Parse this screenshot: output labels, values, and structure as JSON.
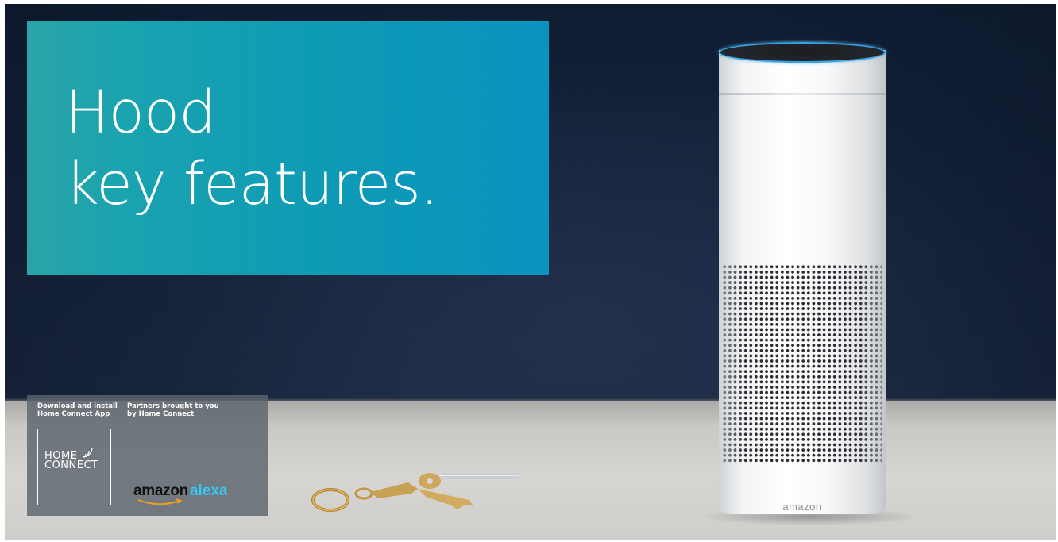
{
  "hero": {
    "title_line1": "Hood",
    "title_line2": "key features."
  },
  "partner_panel": {
    "download_line1": "Download and install",
    "download_line2": "Home Connect App",
    "partners_line1": "Partners brought to you",
    "partners_line2": "by Home Connect",
    "home_connect_logo": {
      "line1": "HOME",
      "line2": "CONNECT"
    },
    "alexa_logo": {
      "brand": "amazon",
      "product": "alexa"
    }
  },
  "device": {
    "brand": "amazon"
  },
  "colors": {
    "hero_teal": "#1aa3b0",
    "alexa_blue": "#38c6f4",
    "wall_navy": "#18263f"
  }
}
